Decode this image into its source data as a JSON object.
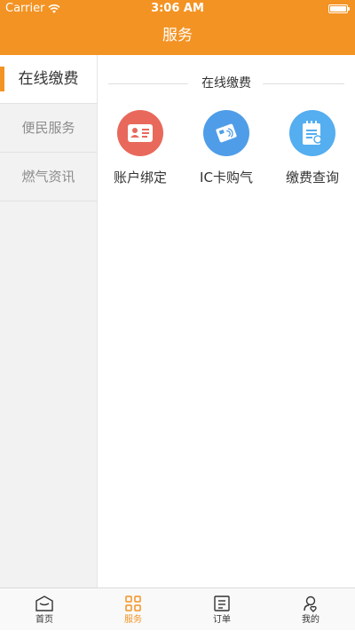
{
  "status_bar": {
    "carrier": "Carrier",
    "time": "3:06 AM"
  },
  "header": {
    "title": "服务"
  },
  "colors": {
    "accent": "#F39323",
    "account_icon": "#E8695B",
    "ic_icon": "#4F9DE8",
    "query_icon": "#54AEEF"
  },
  "sidebar": {
    "items": [
      {
        "label": "在线缴费",
        "active": true
      },
      {
        "label": "便民服务",
        "active": false
      },
      {
        "label": "燃气资讯",
        "active": false
      }
    ]
  },
  "content": {
    "section_title": "在线缴费",
    "services": [
      {
        "label": "账户绑定",
        "icon": "id-card-icon"
      },
      {
        "label": "IC卡购气",
        "icon": "ic-card-icon"
      },
      {
        "label": "缴费查询",
        "icon": "notepad-search-icon"
      }
    ]
  },
  "tabbar": {
    "tabs": [
      {
        "label": "首页",
        "icon": "home-icon",
        "active": false
      },
      {
        "label": "服务",
        "icon": "grid-icon",
        "active": true
      },
      {
        "label": "订单",
        "icon": "order-icon",
        "active": false
      },
      {
        "label": "我的",
        "icon": "profile-icon",
        "active": false
      }
    ]
  }
}
